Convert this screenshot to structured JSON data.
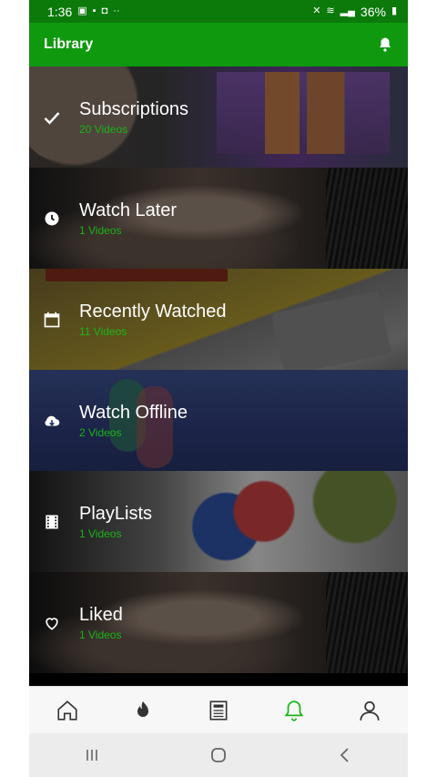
{
  "status_bar": {
    "time": "1:36",
    "battery": "36%"
  },
  "header": {
    "title": "Library",
    "notifications_icon": "bell-icon"
  },
  "library": {
    "items": [
      {
        "title": "Subscriptions",
        "count": "20 Videos",
        "icon": "check-icon"
      },
      {
        "title": "Watch Later",
        "count": "1 Videos",
        "icon": "clock-icon"
      },
      {
        "title": "Recently Watched",
        "count": "11 Videos",
        "icon": "calendar-icon"
      },
      {
        "title": "Watch Offline",
        "count": "2 Videos",
        "icon": "cloud-download-icon"
      },
      {
        "title": "PlayLists",
        "count": "1 Videos",
        "icon": "film-icon"
      },
      {
        "title": "Liked",
        "count": "1 Videos",
        "icon": "heart-icon"
      }
    ]
  },
  "bottom_nav": {
    "items": [
      {
        "icon": "home-icon"
      },
      {
        "icon": "fire-icon"
      },
      {
        "icon": "news-icon"
      },
      {
        "icon": "bell-icon",
        "active": true
      },
      {
        "icon": "profile-icon"
      }
    ],
    "active_color": "#18b418",
    "inactive_color": "#333333"
  },
  "system_nav": {
    "items": [
      {
        "icon": "recents-icon"
      },
      {
        "icon": "home-circle-icon"
      },
      {
        "icon": "back-icon"
      }
    ]
  },
  "colors": {
    "statusbar": "#0b7a0b",
    "appbar": "#0e990e",
    "accent": "#18b418"
  }
}
